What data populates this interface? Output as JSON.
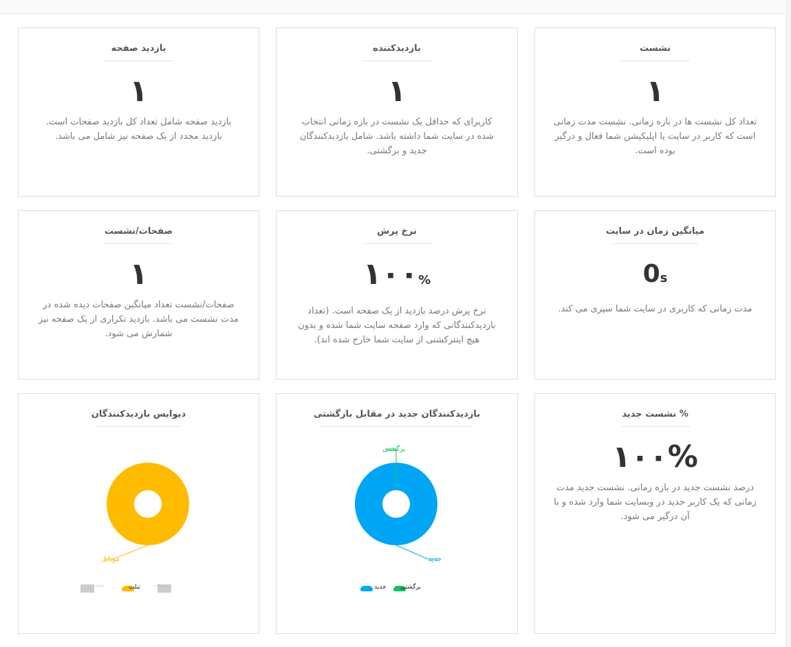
{
  "colors": {
    "orange": "#ffbb00",
    "blue": "#00a6f5",
    "green": "#16c25a",
    "grey": "#cccccc"
  },
  "cards": {
    "sessions": {
      "title": "نشست",
      "value": "۱",
      "desc": "تعداد کل نشست ها در بازه زمانی. نشست مدت زمانی است که کاربر در سایت یا اپلیکیشن شما فعال و درگیر بوده است."
    },
    "visitors": {
      "title": "بازدیدکننده",
      "value": "۱",
      "desc": "کاربرای که حداقل یک نشست در بازه زمانی انتخاب شده در سایت شما داشته باشد. شامل بازدیدکنندگان جدید و برگشتی."
    },
    "pageviews": {
      "title": "بازدید صفحه",
      "value": "۱",
      "desc": "بازدید صفحه شامل تعداد کل بازدید صفحات است. بازدید مجدد از یک صفحه نیز شامل می باشد."
    },
    "avg_time": {
      "title": "میانگین زمان در سایت",
      "value": "0",
      "unit": "s",
      "desc": "مدت زمانی که کاربری در سایت شما سپری می کند."
    },
    "bounce": {
      "title": "نرخ پرش",
      "value": "۱۰۰",
      "unit": "%",
      "desc": "نرخ پرش درصد بازدید از یک صفحه است. (تعداد بازدیدکنندگانی که وارد صفحه سایت شما شده و بدون هیچ اینترکشنی از سایت شما خارج شده اند)."
    },
    "pages_per_session": {
      "title": "صفحات/نشست",
      "value": "۱",
      "desc": "صفحات/نشست تعداد میانگین صفحات دیده شده در مدت نشست می باشد. بازدید تکراری از یک صفحه نیز شمارش می شود."
    },
    "new_sessions": {
      "title": "% نشست جدید",
      "value": "۱۰۰%",
      "desc": "درصد نشست جدید در بازه زمانی. نشست جدید مدت زمانی که یک کاربر جدید در وبسایت شما وارد شده و با آن درگیر می شود."
    },
    "new_vs_returning": {
      "title": "بازدیدکنندگان جدید در مقابل بازگشتی",
      "callout_top": "برگشتی",
      "callout_bottom": "جدید",
      "legend": [
        "جدید",
        "برگشتی"
      ]
    },
    "devices": {
      "title": "دیوایس بازدیدکنندگان",
      "callout_bottom": "موبایل",
      "legend": [
        "موبایل",
        "تبلت",
        "دسکتاپ"
      ]
    }
  },
  "chart_data": [
    {
      "type": "pie",
      "title": "بازدیدکنندگان جدید در مقابل بازگشتی",
      "categories": [
        "جدید",
        "برگشتی"
      ],
      "values": [
        1,
        0
      ]
    },
    {
      "type": "pie",
      "title": "دیوایس بازدیدکنندگان",
      "categories": [
        "موبایل",
        "تبلت",
        "دسکتاپ"
      ],
      "values": [
        1,
        0,
        0
      ]
    }
  ]
}
